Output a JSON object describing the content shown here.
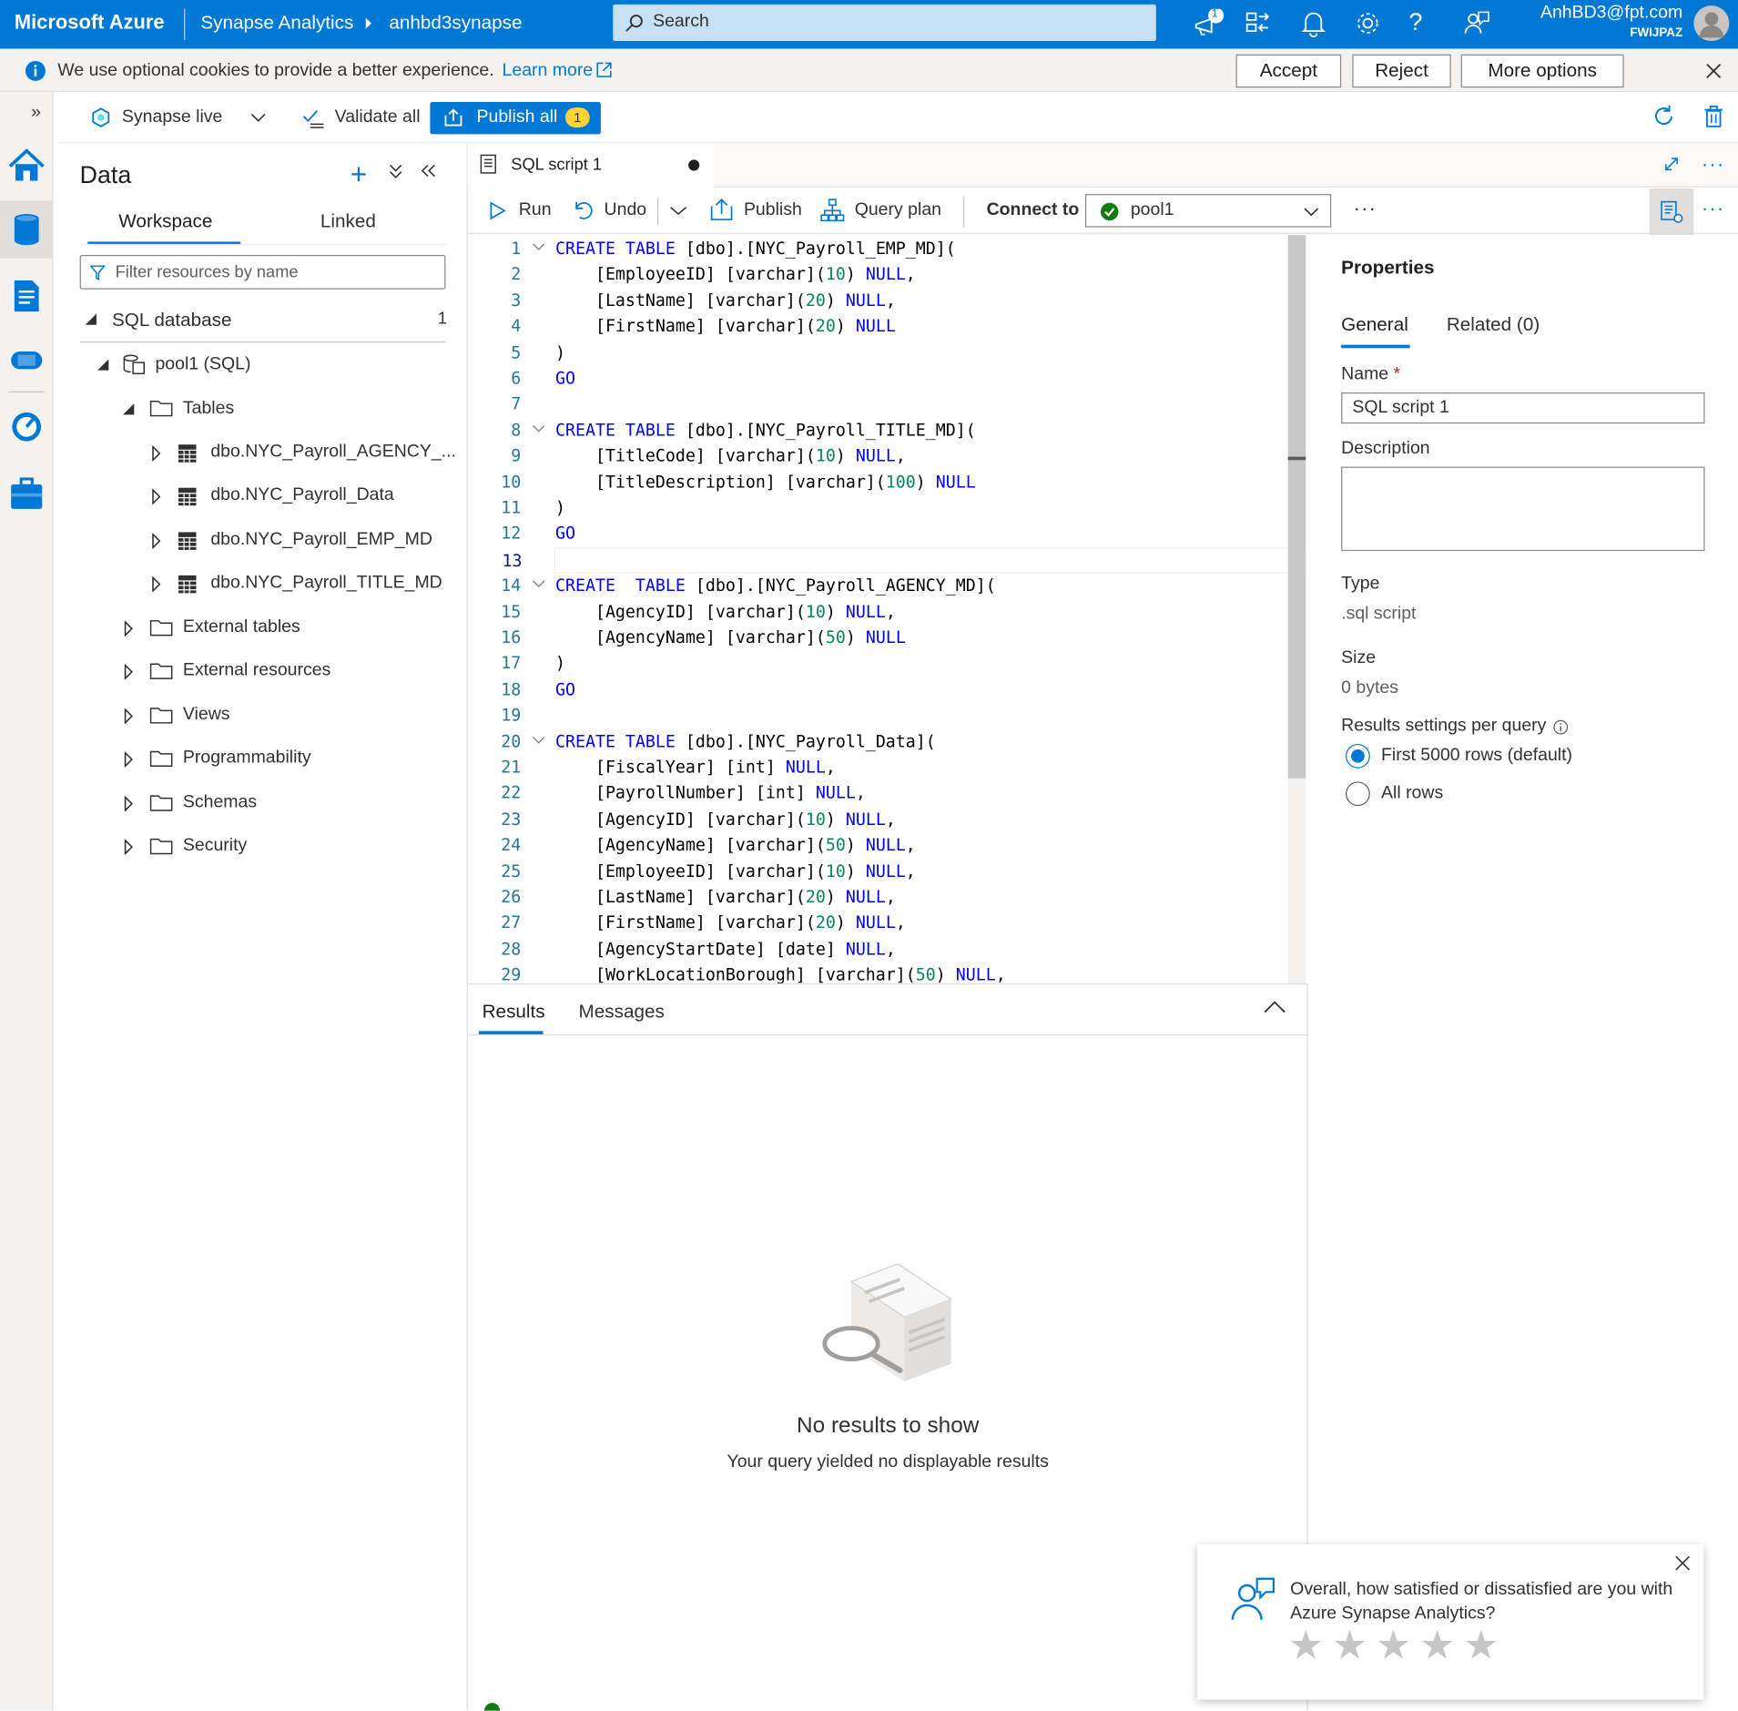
{
  "topbar": {
    "brand": "Microsoft Azure",
    "crumb1": "Synapse Analytics",
    "crumb2": "anhbd3synapse",
    "search_placeholder": "Search",
    "notif_count": "1",
    "user": "AnhBD3@fpt.com",
    "tenant": "FWIJPAZ"
  },
  "cookie": {
    "message": "We use optional cookies to provide a better experience.",
    "learn_more": "Learn more",
    "accept": "Accept",
    "reject": "Reject",
    "more_options": "More options"
  },
  "cmdbar": {
    "synapse_live": "Synapse live",
    "validate_all": "Validate all",
    "publish_all": "Publish all",
    "publish_count": "1"
  },
  "data_panel": {
    "title": "Data",
    "tabs": [
      "Workspace",
      "Linked"
    ],
    "filter_placeholder": "Filter resources by name",
    "section": "SQL database",
    "section_count": "1",
    "pool": "pool1 (SQL)",
    "tables": "Tables",
    "table_items": [
      "dbo.NYC_Payroll_AGENCY_...",
      "dbo.NYC_Payroll_Data",
      "dbo.NYC_Payroll_EMP_MD",
      "dbo.NYC_Payroll_TITLE_MD"
    ],
    "folders": [
      "External tables",
      "External resources",
      "Views",
      "Programmability",
      "Schemas",
      "Security"
    ]
  },
  "editor": {
    "tab_title": "SQL script 1",
    "run": "Run",
    "undo": "Undo",
    "publish": "Publish",
    "query_plan": "Query plan",
    "connect_to": "Connect to",
    "pool": "pool1",
    "lines": [
      {
        "n": "1",
        "t": "<span class=\"kw\">CREATE TABLE</span> [dbo].[NYC_Payroll_EMP_MD](",
        "fold": true
      },
      {
        "n": "2",
        "t": "    [EmployeeID] [varchar](<span class=\"num\">10</span>) <span class=\"kw\">NULL</span>,"
      },
      {
        "n": "3",
        "t": "    [LastName] [varchar](<span class=\"num\">20</span>) <span class=\"kw\">NULL</span>,"
      },
      {
        "n": "4",
        "t": "    [FirstName] [varchar](<span class=\"num\">20</span>) <span class=\"kw\">NULL</span>"
      },
      {
        "n": "5",
        "t": ")"
      },
      {
        "n": "6",
        "t": "<span class=\"kw\">GO</span>"
      },
      {
        "n": "7",
        "t": ""
      },
      {
        "n": "8",
        "t": "<span class=\"kw\">CREATE TABLE</span> [dbo].[NYC_Payroll_TITLE_MD](",
        "fold": true
      },
      {
        "n": "9",
        "t": "    [TitleCode] [varchar](<span class=\"num\">10</span>) <span class=\"kw\">NULL</span>,"
      },
      {
        "n": "10",
        "t": "    [TitleDescription] [varchar](<span class=\"num\">100</span>) <span class=\"kw\">NULL</span>"
      },
      {
        "n": "11",
        "t": ")"
      },
      {
        "n": "12",
        "t": "<span class=\"kw\">GO</span>"
      },
      {
        "n": "13",
        "t": "",
        "current": true
      },
      {
        "n": "14",
        "t": "<span class=\"kw\">CREATE  TABLE</span> [dbo].[NYC_Payroll_AGENCY_MD](",
        "fold": true
      },
      {
        "n": "15",
        "t": "    [AgencyID] [varchar](<span class=\"num\">10</span>) <span class=\"kw\">NULL</span>,"
      },
      {
        "n": "16",
        "t": "    [AgencyName] [varchar](<span class=\"num\">50</span>) <span class=\"kw\">NULL</span>"
      },
      {
        "n": "17",
        "t": ")"
      },
      {
        "n": "18",
        "t": "<span class=\"kw\">GO</span>"
      },
      {
        "n": "19",
        "t": ""
      },
      {
        "n": "20",
        "t": "<span class=\"kw\">CREATE TABLE</span> [dbo].[NYC_Payroll_Data](",
        "fold": true
      },
      {
        "n": "21",
        "t": "    [FiscalYear] [int] <span class=\"kw\">NULL</span>,"
      },
      {
        "n": "22",
        "t": "    [PayrollNumber] [int] <span class=\"kw\">NULL</span>,"
      },
      {
        "n": "23",
        "t": "    [AgencyID] [varchar](<span class=\"num\">10</span>) <span class=\"kw\">NULL</span>,"
      },
      {
        "n": "24",
        "t": "    [AgencyName] [varchar](<span class=\"num\">50</span>) <span class=\"kw\">NULL</span>,"
      },
      {
        "n": "25",
        "t": "    [EmployeeID] [varchar](<span class=\"num\">10</span>) <span class=\"kw\">NULL</span>,"
      },
      {
        "n": "26",
        "t": "    [LastName] [varchar](<span class=\"num\">20</span>) <span class=\"kw\">NULL</span>,"
      },
      {
        "n": "27",
        "t": "    [FirstName] [varchar](<span class=\"num\">20</span>) <span class=\"kw\">NULL</span>,"
      },
      {
        "n": "28",
        "t": "    [AgencyStartDate] [date] <span class=\"kw\">NULL</span>,"
      },
      {
        "n": "29",
        "t": "    [WorkLocationBorough] [varchar](<span class=\"num\">50</span>) <span class=\"kw\">NULL</span>,"
      }
    ]
  },
  "results": {
    "tabs": [
      "Results",
      "Messages"
    ],
    "empty_title": "No results to show",
    "empty_sub": "Your query yielded no displayable results"
  },
  "properties": {
    "title": "Properties",
    "tabs": [
      "General",
      "Related (0)"
    ],
    "name_label": "Name",
    "name_value": "SQL script 1",
    "description_label": "Description",
    "type_label": "Type",
    "type_value": ".sql script",
    "size_label": "Size",
    "size_value": "0 bytes",
    "results_settings_label": "Results settings per query",
    "option1": "First 5000 rows (default)",
    "option2": "All rows"
  },
  "survey": {
    "question": "Overall, how satisfied or dissatisfied are you with Azure Synapse Analytics?",
    "stars": 5
  },
  "colors": {
    "azure_blue": "#0078d4",
    "keyword": "#0000ff",
    "number": "#098658",
    "line_number": "#237893"
  }
}
